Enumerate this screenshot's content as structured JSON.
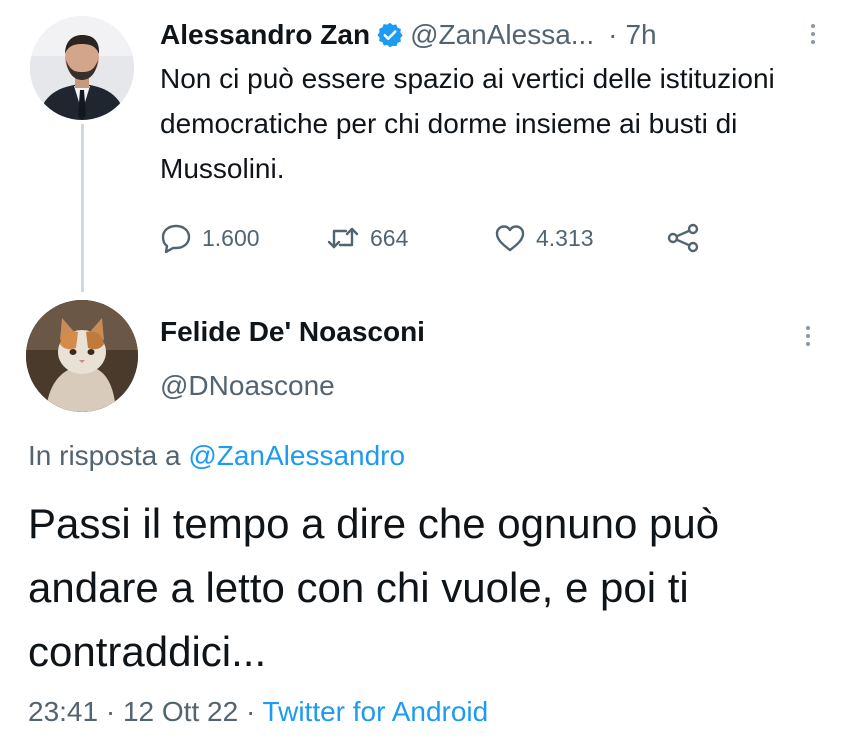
{
  "parent_tweet": {
    "display_name": "Alessandro Zan",
    "handle": "@ZanAlessa...",
    "separator": "·",
    "time": "7h",
    "text": "Non ci può essere spazio ai vertici delle istituzioni democratiche per chi dorme insieme ai busti di Mussolini.",
    "actions": {
      "replies": "1.600",
      "retweets": "664",
      "likes": "4.313"
    },
    "icons": {
      "verified": "verified-badge-icon",
      "reply": "reply-icon",
      "retweet": "retweet-icon",
      "like": "heart-icon",
      "share": "share-icon",
      "more": "more-vertical-icon"
    }
  },
  "reply_tweet": {
    "display_name": "Felide De' Noasconi",
    "handle": "@DNoascone",
    "context_prefix": "In risposta a",
    "context_mention": "@ZanAlessandro",
    "text": "Passi il tempo a dire che ognuno può andare a letto con chi vuole, e poi ti contraddici...",
    "time": "23:41",
    "separator_1": "·",
    "date": "12 Ott 22",
    "separator_2": "·",
    "source": "Twitter for Android"
  },
  "colors": {
    "text": "#0f1419",
    "secondary": "#536471",
    "accent": "#1d9bf0",
    "thread_line": "#cfd9de"
  }
}
